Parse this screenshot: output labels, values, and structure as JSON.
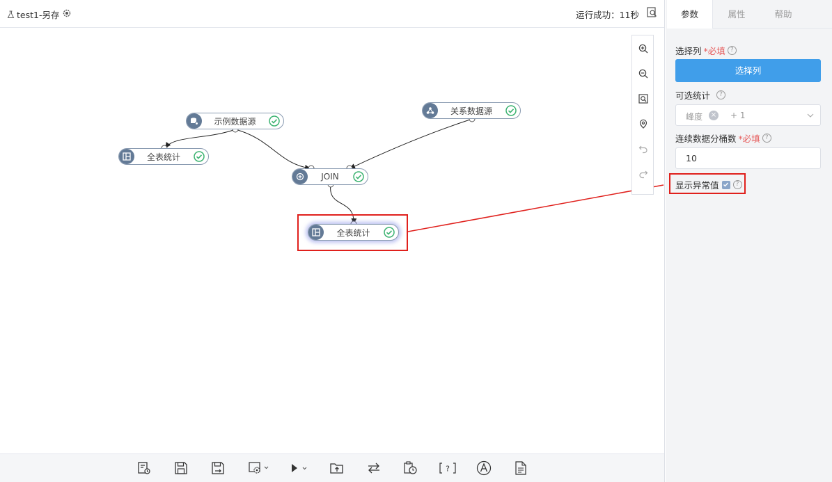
{
  "header": {
    "flow_title": "test1-另存",
    "run_status": "运行成功：11秒"
  },
  "nodes": {
    "sample_source": "示例数据源",
    "full_stats_1": "全表统计",
    "relational_source": "关系数据源",
    "join": "JOIN",
    "full_stats_2": "全表统计"
  },
  "zoom_toolbar": [
    "zoom-in-icon",
    "zoom-out-icon",
    "fit-view-icon",
    "locate-icon",
    "undo-icon",
    "redo-icon"
  ],
  "bottom_toolbar": [
    "schedule-icon",
    "save-icon",
    "save-as-icon",
    "settings-dropdown-icon",
    "run-dropdown-icon",
    "publish-icon",
    "switch-icon",
    "history-icon",
    "help-bracket-icon",
    "font-icon",
    "document-icon"
  ],
  "right_panel": {
    "tabs": [
      "参数",
      "属性",
      "帮助"
    ],
    "active_tab": "参数",
    "select_columns": {
      "label": "选择列",
      "required": "*必填",
      "button": "选择列"
    },
    "optional_stats": {
      "label": "可选统计",
      "tag": "峰度",
      "more": "+ 1"
    },
    "bucket_count": {
      "label": "连续数据分桶数",
      "required": "*必填",
      "value": "10"
    },
    "show_outliers": {
      "label": "显示异常值",
      "checked": true
    }
  },
  "colors": {
    "accent": "#409eea",
    "node_icon": "#637a96",
    "success": "#3cb371",
    "highlight": "#e0201c"
  }
}
